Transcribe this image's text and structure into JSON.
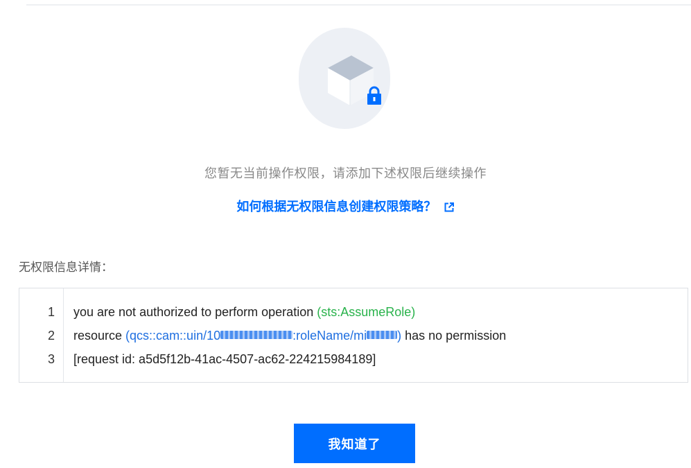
{
  "dialog": {
    "notice": "您暂无当前操作权限，请添加下述权限后继续操作",
    "help_link": "如何根据无权限信息创建权限策略？",
    "help_link_icon": "external-link-icon",
    "illustration_icon": "locked-box-icon",
    "detail_label": "无权限信息详情：",
    "code_lines": [
      {
        "number": "1",
        "text": "you are not authorized to perform operation ",
        "highlight": "(sts:AssumeRole)"
      },
      {
        "number": "2",
        "prefix": "resource ",
        "resource_start": "(qcs::cam::uin/10",
        "resource_mid": ":roleName/mi",
        "resource_end": ")",
        "suffix": " has no permission"
      },
      {
        "number": "3",
        "text": "[request id: a5d5f12b-41ac-4507-ac62-224215984189]"
      }
    ],
    "ok_button": "我知道了"
  },
  "colors": {
    "primary": "#006eff",
    "highlight_green": "#29b24b",
    "resource_blue": "#1f6fe0",
    "muted_text": "#888888"
  }
}
